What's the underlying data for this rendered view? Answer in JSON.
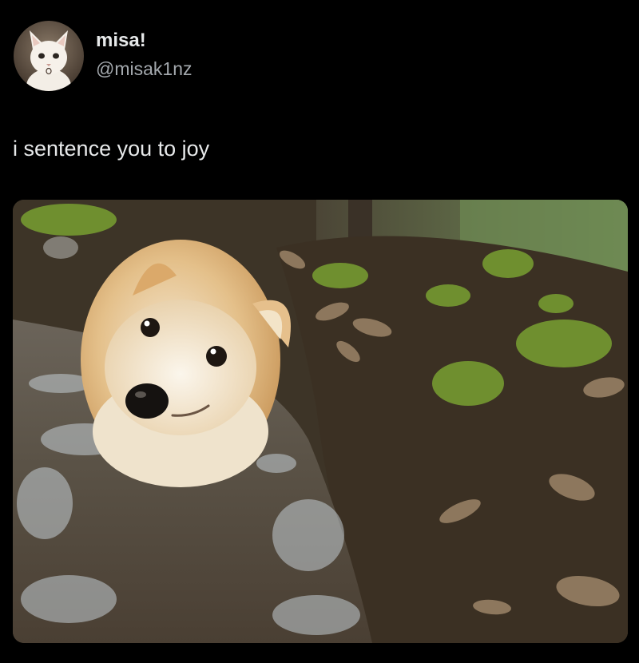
{
  "tweet": {
    "author": {
      "display_name": "misa!",
      "handle": "@misak1nz",
      "avatar_icon": "cat-avatar-icon"
    },
    "text": "i sentence you to joy",
    "media": {
      "icon": "corgi-photo"
    }
  },
  "colors": {
    "background": "#000000",
    "text_primary": "#e7e9ea",
    "text_secondary": "#a3a8ad"
  }
}
